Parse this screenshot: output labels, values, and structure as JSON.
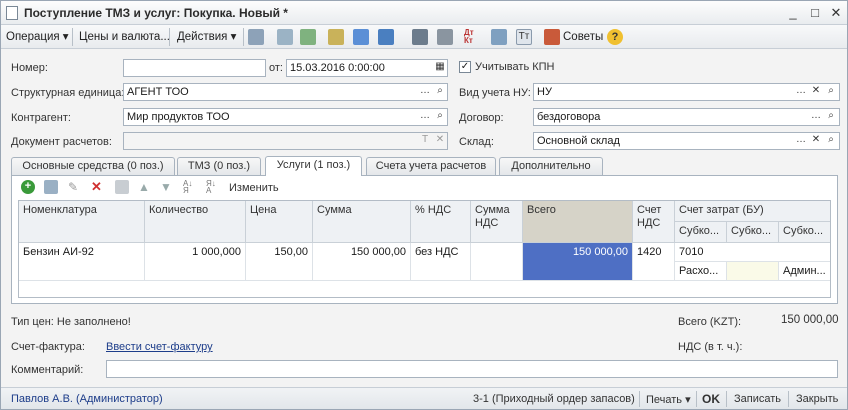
{
  "window": {
    "title": "Поступление ТМЗ и услуг: Покупка. Новый *"
  },
  "toolbar": {
    "operation": "Операция",
    "prices": "Цены и валюта...",
    "actions": "Действия",
    "tips": "Советы"
  },
  "form": {
    "number_label": "Номер:",
    "number_value": "",
    "from_label": "от:",
    "date_value": "15.03.2016  0:00:00",
    "kpn_label": "Учитывать КПН",
    "unit_label": "Структурная единица:",
    "unit_value": "АГЕНТ ТОО",
    "nu_label": "Вид учета НУ:",
    "nu_value": "НУ",
    "contractor_label": "Контрагент:",
    "contractor_value": "Мир продуктов ТОО",
    "contract_label": "Договор:",
    "contract_value": "бездоговора",
    "settlement_label": "Документ расчетов:",
    "settlement_value": "",
    "warehouse_label": "Склад:",
    "warehouse_value": "Основной склад"
  },
  "tabs": [
    {
      "label": "Основные средства (0 поз.)"
    },
    {
      "label": "ТМЗ (0 поз.)"
    },
    {
      "label": "Услуги (1 поз.)"
    },
    {
      "label": "Счета учета расчетов"
    },
    {
      "label": "Дополнительно"
    }
  ],
  "grid_toolbar": {
    "change": "Изменить"
  },
  "grid": {
    "headers": {
      "nomenclature": "Номенклатура",
      "quantity": "Количество",
      "price": "Цена",
      "sum": "Сумма",
      "vat_pct": "% НДС",
      "vat_sum": "Сумма НДС",
      "total": "Всего",
      "account": "Счет НДС",
      "cost_account": "Счет затрат (БУ)",
      "subko1": "Субко...",
      "subko2": "Субко...",
      "subko3": "Субко..."
    },
    "row": {
      "nomenclature": "Бензин АИ-92",
      "quantity": "1 000,000",
      "price": "150,00",
      "sum": "150 000,00",
      "vat_pct": "без НДС",
      "vat_sum": "",
      "total": "150 000,00",
      "account": "1420",
      "cost_account": "7010",
      "subko1": "Расхо...",
      "subko2": "",
      "subko3": "Админ..."
    }
  },
  "footer": {
    "price_type": "Тип цен: Не заполнено!",
    "total_label": "Всего (KZT):",
    "total_value": "150 000,00",
    "invoice_label": "Счет-фактура:",
    "invoice_link": "Ввести счет-фактуру",
    "vat_label": "НДС (в т. ч.):",
    "comment_label": "Комментарий:"
  },
  "status": {
    "user": "Павлов А.В. (Администратор)",
    "order": "3-1 (Приходный ордер запасов)",
    "print": "Печать",
    "ok": "OK",
    "save": "Записать",
    "close": "Закрыть"
  },
  "colors": {
    "selected_cell": "#4e6fc4",
    "total_header": "#d6d3c8"
  }
}
